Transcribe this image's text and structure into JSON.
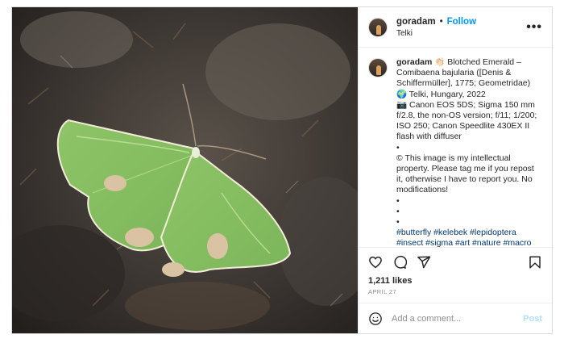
{
  "header": {
    "username": "goradam",
    "separator": "•",
    "follow_label": "Follow",
    "location": "Telki",
    "more_icon": "more-horizontal-icon"
  },
  "photo": {
    "subject": "green moth on mossy rock",
    "colors": {
      "wing": "#8fc468",
      "wing_light": "#b9dd95",
      "patch": "#d9c3a3",
      "rock": "#3a3632"
    }
  },
  "caption": {
    "username": "goradam",
    "text": "👏🏻 Blotched Emerald – Comibaena bajularia ([Denis & Schiffermüller], 1775; Geometridae)",
    "line2": "🌍 Telki, Hungary, 2022",
    "line3": "📷 Canon EOS 5DS; Sigma 150 mm f/2.8, the non-OS version; f/11; 1/200; ISO 250; Canon Speedlite 430EX II flash with diffuser",
    "bullet1": "•",
    "line4": "© This image is my intellectual property. Please tag me if you repost it, otherwise I have to report you. No modifications!",
    "bullet2": "•",
    "bullet3": "•",
    "bullet4": "•",
    "hashtags": "#butterfly #kelebek #lepidoptera #insect #sigma #art #nature #macro"
  },
  "actions": {
    "like_icon": "heart-icon",
    "comment_icon": "comment-icon",
    "share_icon": "share-icon",
    "save_icon": "bookmark-icon"
  },
  "likes": "1,211 likes",
  "date": "APRIL 27",
  "comment": {
    "emoji_icon": "emoji-icon",
    "placeholder": "Add a comment...",
    "post_label": "Post"
  },
  "colors": {
    "accent": "#0095f6",
    "post_disabled": "#b2dffc",
    "hashtag": "#00376b",
    "muted": "#8e8e8e"
  }
}
